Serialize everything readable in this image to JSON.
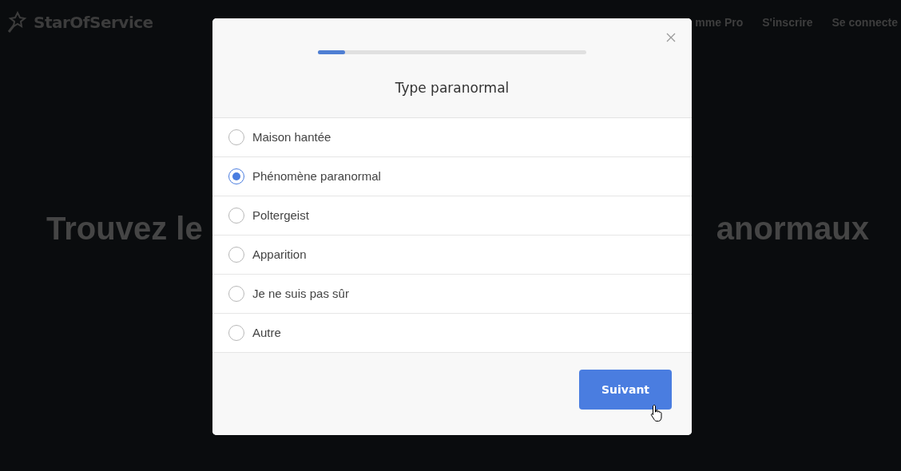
{
  "navbar": {
    "logo": "StarOfService",
    "links": [
      "mme Pro",
      "S'inscrire",
      "Se connecte"
    ]
  },
  "hero": {
    "title_left": "Trouvez le",
    "title_right": "anormaux"
  },
  "modal": {
    "progress": {
      "level": 0.1
    },
    "title": "Type paranormal",
    "options": [
      {
        "label": "Maison hantée",
        "selected": false
      },
      {
        "label": "Phénomène paranormal",
        "selected": true
      },
      {
        "label": "Poltergeist",
        "selected": false
      },
      {
        "label": "Apparition",
        "selected": false
      },
      {
        "label": "Je ne suis pas sûr",
        "selected": false
      },
      {
        "label": "Autre",
        "selected": false
      }
    ],
    "next_button": "Suivant"
  }
}
